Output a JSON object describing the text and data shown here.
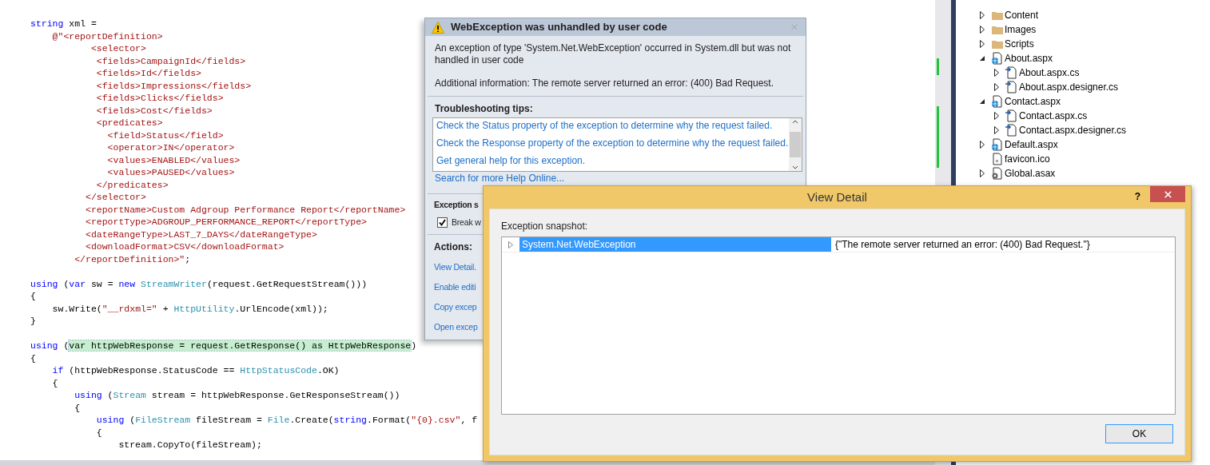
{
  "editor": {
    "code_blocks": [
      [
        {
          "tokens": [
            {
              "kind": "keyword",
              "text": "string"
            },
            {
              "kind": "plain",
              "text": " xml ="
            }
          ]
        },
        {
          "tokens": [
            {
              "kind": "string",
              "text": "    @\"<reportDefinition>"
            }
          ]
        },
        {
          "tokens": [
            {
              "kind": "string",
              "text": "           <selector>"
            }
          ]
        },
        {
          "tokens": [
            {
              "kind": "string",
              "text": "            <fields>CampaignId</fields>"
            }
          ]
        },
        {
          "tokens": [
            {
              "kind": "string",
              "text": "            <fields>Id</fields>"
            }
          ]
        },
        {
          "tokens": [
            {
              "kind": "string",
              "text": "            <fields>Impressions</fields>"
            }
          ]
        },
        {
          "tokens": [
            {
              "kind": "string",
              "text": "            <fields>Clicks</fields>"
            }
          ]
        },
        {
          "tokens": [
            {
              "kind": "string",
              "text": "            <fields>Cost</fields>"
            }
          ]
        },
        {
          "tokens": [
            {
              "kind": "string",
              "text": "            <predicates>"
            }
          ]
        },
        {
          "tokens": [
            {
              "kind": "string",
              "text": "              <field>Status</field>"
            }
          ]
        },
        {
          "tokens": [
            {
              "kind": "string",
              "text": "              <operator>IN</operator>"
            }
          ]
        },
        {
          "tokens": [
            {
              "kind": "string",
              "text": "              <values>ENABLED</values>"
            }
          ]
        },
        {
          "tokens": [
            {
              "kind": "string",
              "text": "              <values>PAUSED</values>"
            }
          ]
        },
        {
          "tokens": [
            {
              "kind": "string",
              "text": "            </predicates>"
            }
          ]
        },
        {
          "tokens": [
            {
              "kind": "string",
              "text": "          </selector>"
            }
          ]
        },
        {
          "tokens": [
            {
              "kind": "string",
              "text": "          <reportName>Custom Adgroup Performance Report</reportName>"
            }
          ]
        },
        {
          "tokens": [
            {
              "kind": "string",
              "text": "          <reportType>ADGROUP_PERFORMANCE_REPORT</reportType>"
            }
          ]
        },
        {
          "tokens": [
            {
              "kind": "string",
              "text": "          <dateRangeType>LAST_7_DAYS</dateRangeType>"
            }
          ]
        },
        {
          "tokens": [
            {
              "kind": "string",
              "text": "          <downloadFormat>CSV</downloadFormat>"
            }
          ]
        },
        {
          "tokens": [
            {
              "kind": "string",
              "text": "        </reportDefinition>\""
            },
            {
              "kind": "plain",
              "text": ";"
            }
          ]
        }
      ],
      [
        {
          "tokens": [
            {
              "kind": "keyword",
              "text": "using"
            },
            {
              "kind": "plain",
              "text": " ("
            },
            {
              "kind": "keyword",
              "text": "var"
            },
            {
              "kind": "plain",
              "text": " sw = "
            },
            {
              "kind": "keyword",
              "text": "new "
            },
            {
              "kind": "type",
              "text": "StreamWriter"
            },
            {
              "kind": "plain",
              "text": "(request.GetRequestStream()))"
            }
          ]
        },
        {
          "tokens": [
            {
              "kind": "plain",
              "text": "{"
            }
          ]
        },
        {
          "tokens": [
            {
              "kind": "plain",
              "text": "    sw.Write("
            },
            {
              "kind": "string",
              "text": "\"__rdxml=\""
            },
            {
              "kind": "plain",
              "text": " + "
            },
            {
              "kind": "type",
              "text": "HttpUtility"
            },
            {
              "kind": "plain",
              "text": ".UrlEncode(xml));"
            }
          ]
        },
        {
          "tokens": [
            {
              "kind": "plain",
              "text": "}"
            }
          ]
        }
      ],
      [
        {
          "tokens": [
            {
              "kind": "keyword",
              "text": "using"
            },
            {
              "kind": "plain",
              "text": " ("
            },
            {
              "kind": "highlight",
              "text": "var httpWebResponse = request.GetResponse() as HttpWebResponse"
            },
            {
              "kind": "plain",
              "text": ")"
            }
          ]
        },
        {
          "tokens": [
            {
              "kind": "plain",
              "text": "{"
            }
          ]
        },
        {
          "tokens": [
            {
              "kind": "keyword",
              "text": "    if"
            },
            {
              "kind": "plain",
              "text": " (httpWebResponse.StatusCode == "
            },
            {
              "kind": "type",
              "text": "HttpStatusCode"
            },
            {
              "kind": "plain",
              "text": ".OK)"
            }
          ]
        },
        {
          "tokens": [
            {
              "kind": "plain",
              "text": "    {"
            }
          ]
        },
        {
          "tokens": [
            {
              "kind": "keyword",
              "text": "        using"
            },
            {
              "kind": "plain",
              "text": " ("
            },
            {
              "kind": "type",
              "text": "Stream"
            },
            {
              "kind": "plain",
              "text": " stream = httpWebResponse.GetResponseStream())"
            }
          ]
        },
        {
          "tokens": [
            {
              "kind": "plain",
              "text": "        {"
            }
          ]
        },
        {
          "tokens": [
            {
              "kind": "keyword",
              "text": "            using"
            },
            {
              "kind": "plain",
              "text": " ("
            },
            {
              "kind": "type",
              "text": "FileStream"
            },
            {
              "kind": "plain",
              "text": " fileStream = "
            },
            {
              "kind": "type",
              "text": "File"
            },
            {
              "kind": "plain",
              "text": ".Create("
            },
            {
              "kind": "keyword",
              "text": "string"
            },
            {
              "kind": "plain",
              "text": ".Format("
            },
            {
              "kind": "string",
              "text": "\"{0}.csv\""
            },
            {
              "kind": "plain",
              "text": ", f"
            }
          ]
        },
        {
          "tokens": [
            {
              "kind": "plain",
              "text": "            {"
            }
          ]
        },
        {
          "tokens": [
            {
              "kind": "plain",
              "text": "                stream.CopyTo(fileStream);"
            }
          ]
        }
      ]
    ]
  },
  "solution_explorer": {
    "items": [
      {
        "name": "Content",
        "kind": "folder",
        "expanded": false
      },
      {
        "name": "Images",
        "kind": "folder",
        "expanded": false
      },
      {
        "name": "Scripts",
        "kind": "folder",
        "expanded": false
      },
      {
        "name": "About.aspx",
        "kind": "web_page",
        "expanded": true,
        "children": [
          {
            "name": "About.aspx.cs",
            "kind": "code_file",
            "expanded": false
          },
          {
            "name": "About.aspx.designer.cs",
            "kind": "code_file",
            "expanded": false
          }
        ]
      },
      {
        "name": "Contact.aspx",
        "kind": "web_page",
        "expanded": true,
        "children": [
          {
            "name": "Contact.aspx.cs",
            "kind": "code_file",
            "expanded": false
          },
          {
            "name": "Contact.aspx.designer.cs",
            "kind": "code_file",
            "expanded": false
          }
        ]
      },
      {
        "name": "Default.aspx",
        "kind": "web_page",
        "expanded": false
      },
      {
        "name": "favicon.ico",
        "kind": "image_file"
      },
      {
        "name": "Global.asax",
        "kind": "settings_file",
        "expanded": false
      }
    ]
  },
  "exception_helper": {
    "title": "WebException was unhandled by user code",
    "message": "An exception of type 'System.Net.WebException' occurred in System.dll but was not handled in user code",
    "additional_info": "Additional information: The remote server returned an error: (400) Bad Request.",
    "tips_heading": "Troubleshooting tips:",
    "tips": [
      "Check the Status property of the exception to determine why the request failed.",
      "Check the Response property of the exception to determine why the request failed.",
      "Get general help for this exception."
    ],
    "search_link": "Search for more Help Online...",
    "settings_heading": "Exception s",
    "break_option": {
      "label": "Break w",
      "checked": true
    },
    "actions_heading": "Actions:",
    "actions": [
      "View Detail.",
      "Enable editi",
      "Copy excep",
      "Open excep"
    ]
  },
  "view_detail": {
    "title": "View Detail",
    "help": "?",
    "snapshot_label": "Exception snapshot:",
    "rows": [
      {
        "name": "System.Net.WebException",
        "value": "{\"The remote server returned an error: (400) Bad Request.\"}",
        "selected": true,
        "expanded": false
      }
    ],
    "ok_button": "OK"
  }
}
